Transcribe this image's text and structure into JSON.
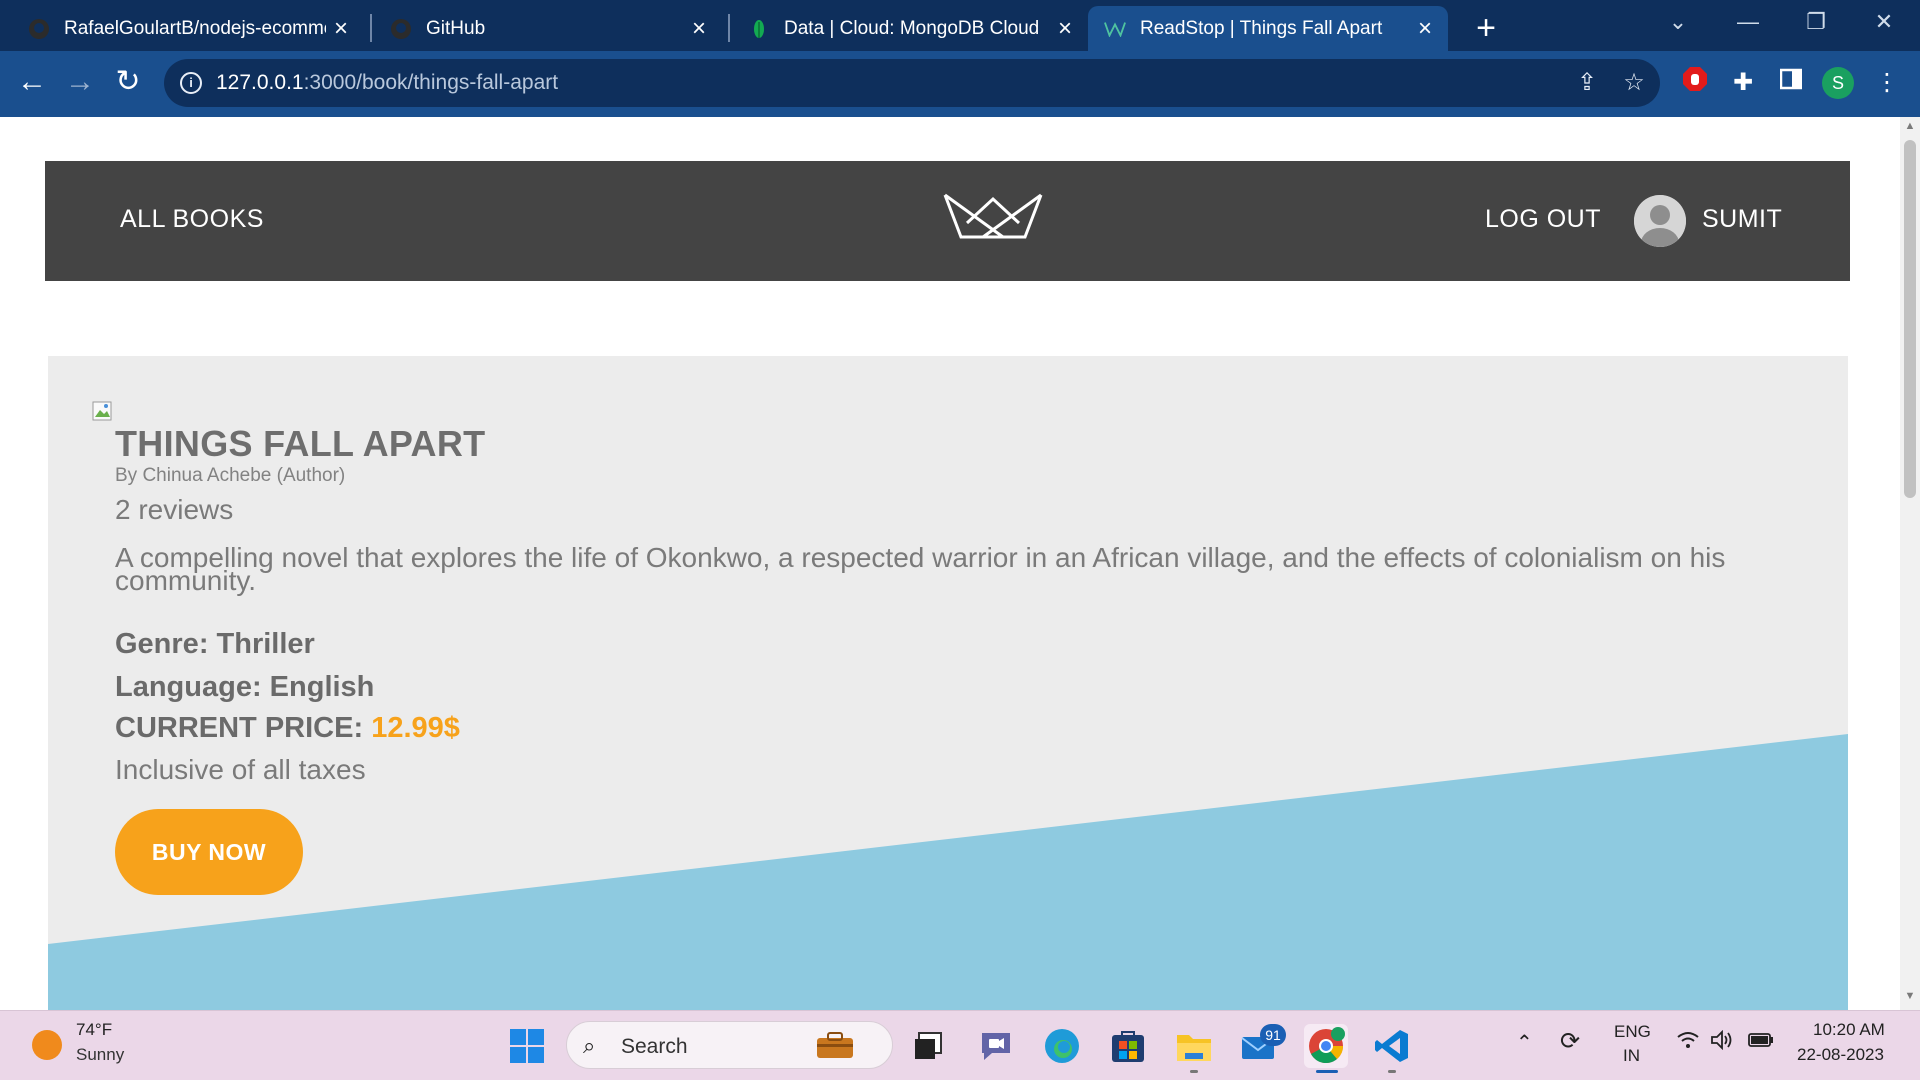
{
  "browser": {
    "tabs": [
      {
        "title": "RafaelGoulartB/nodejs-ecommerce",
        "icon": "github-icon"
      },
      {
        "title": "GitHub",
        "icon": "github-icon"
      },
      {
        "title": "Data | Cloud: MongoDB Cloud",
        "icon": "mongodb-leaf-icon"
      },
      {
        "title": "ReadStop | Things Fall Apart",
        "icon": "readstop-crown-icon",
        "active": true
      }
    ],
    "url_host": "127.0.0.1",
    "url_path": ":3000/book/things-fall-apart",
    "profile_initial": "S"
  },
  "site_nav": {
    "all_books": "ALL BOOKS",
    "log_out": "LOG OUT",
    "user_name": "SUMIT"
  },
  "book": {
    "title": "THINGS FALL APART",
    "author": "By Chinua Achebe (Author)",
    "reviews": "2 reviews",
    "description": "A compelling novel that explores the life of Okonkwo, a respected warrior in an African village, and the effects of colonialism on his community.",
    "genre": "Genre: Thriller",
    "language": "Language: English",
    "price_label": "CURRENT PRICE:",
    "price_value": "12.99$",
    "tax_note": "Inclusive of all taxes",
    "buy_label": "BUY NOW"
  },
  "colors": {
    "nav_bg": "#444444",
    "panel_bg": "#ececec",
    "accent": "#f7a21b",
    "diagonal": "#8ecae0"
  },
  "taskbar": {
    "weather_temp": "74°F",
    "weather_desc": "Sunny",
    "search_label": "Search",
    "mail_badge": "91",
    "lang_1": "ENG",
    "lang_2": "IN",
    "time": "10:20 AM",
    "date": "22-08-2023"
  }
}
